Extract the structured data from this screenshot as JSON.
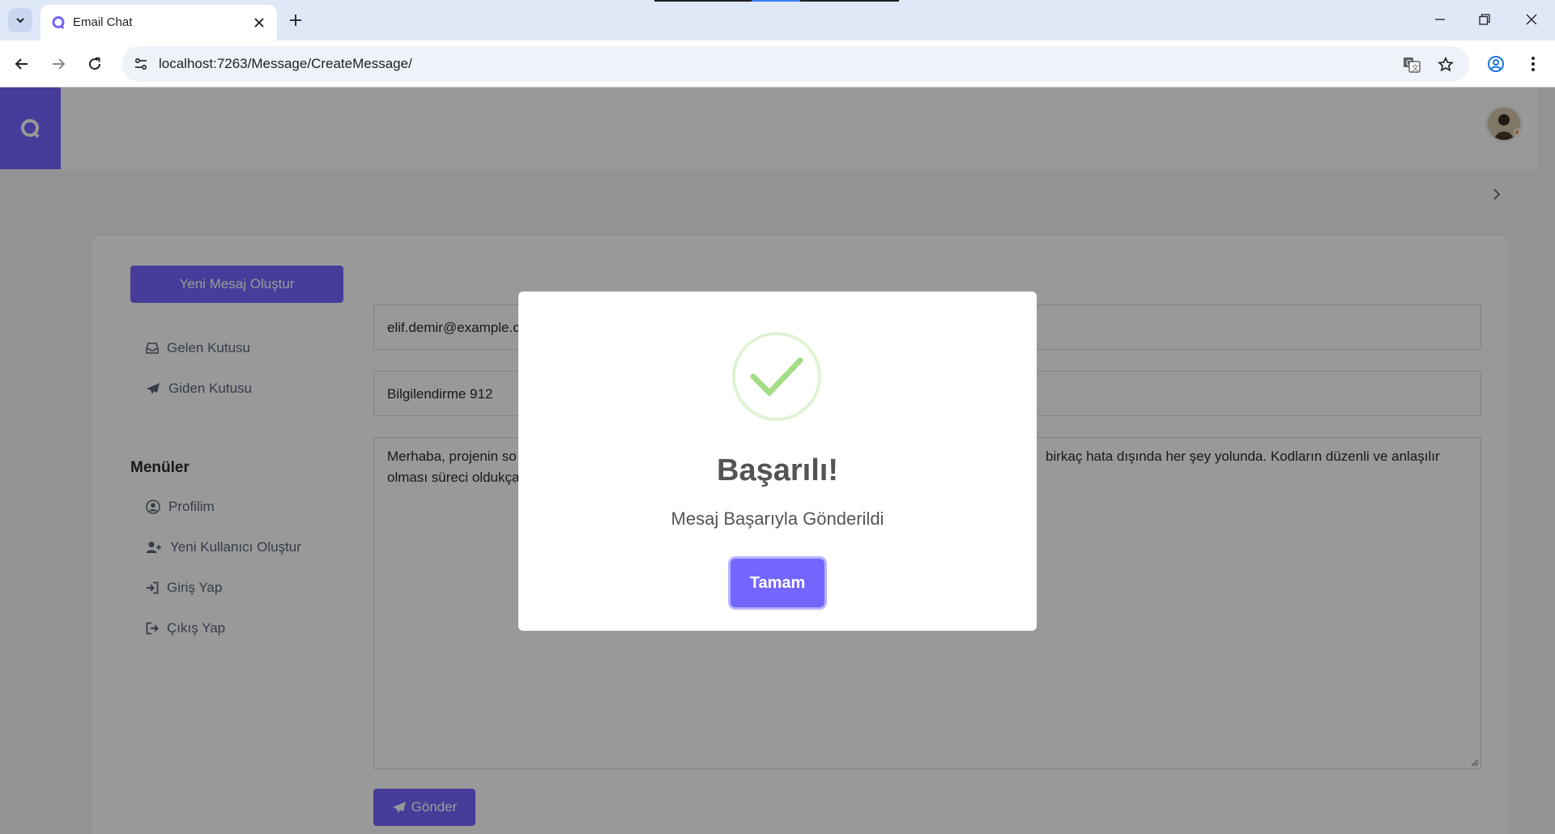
{
  "browser": {
    "tab_title": "Email Chat",
    "url": "localhost:7263/Message/CreateMessage/"
  },
  "sidebar": {
    "new_message_label": "Yeni Mesaj Oluştur",
    "mail_items": [
      {
        "label": "Gelen Kutusu",
        "icon": "inbox-icon"
      },
      {
        "label": "Giden Kutusu",
        "icon": "paper-plane-icon"
      }
    ],
    "menus_heading": "Menüler",
    "menu_items": [
      {
        "label": "Profilim",
        "icon": "user-circle-icon"
      },
      {
        "label": "Yeni Kullanıcı Oluştur",
        "icon": "user-plus-icon"
      },
      {
        "label": "Giriş Yap",
        "icon": "sign-in-icon"
      },
      {
        "label": "Çıkış Yap",
        "icon": "sign-out-icon"
      }
    ]
  },
  "form": {
    "to_value": "elif.demir@example.c",
    "subject_value": "Bilgilendirme 912",
    "body_line1_left": "Merhaba, projenin so",
    "body_line1_right": "birkaç hata dışında her şey yolunda. Kodların düzenli ve anlaşılır",
    "body_line2_left": "olması süreci oldukça",
    "send_label": "Gönder"
  },
  "modal": {
    "title": "Başarılı!",
    "message": "Mesaj Başarıyla Gönderildi",
    "ok_label": "Tamam"
  },
  "colors": {
    "accent": "#7366ff",
    "success": "#a5dc86"
  }
}
